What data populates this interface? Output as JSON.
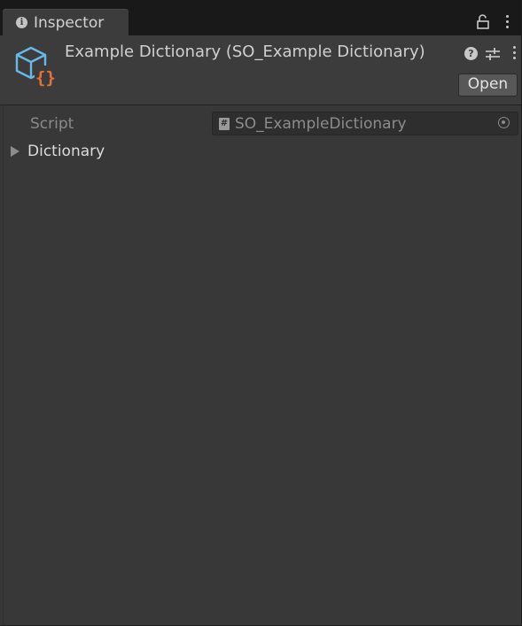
{
  "tab": {
    "title": "Inspector",
    "info_icon": "info-icon",
    "info_glyph": "i"
  },
  "tab_actions": {
    "lock_icon": "lock-icon",
    "menu_icon": "kebab-menu-icon"
  },
  "header": {
    "object_icon": "scriptable-object-icon",
    "title": "Example Dictionary (SO_Example Dictionary)",
    "help_icon": "help-icon",
    "help_glyph": "?",
    "settings_icon": "preset-settings-icon",
    "menu_icon": "kebab-menu-icon",
    "open_label": "Open"
  },
  "fields": {
    "script": {
      "label": "Script",
      "value": "SO_ExampleDictionary",
      "type_icon": "csharp-script-icon",
      "type_glyph": "#",
      "picker_icon": "object-picker-icon"
    },
    "dictionary": {
      "label": "Dictionary",
      "expanded": false,
      "arrow_icon": "foldout-arrow-icon"
    }
  },
  "colors": {
    "background": "#383838",
    "tabbar": "#191919",
    "header": "#3c3c3c",
    "icon_blue": "#6ab8e8",
    "icon_orange": "#e8703a"
  }
}
